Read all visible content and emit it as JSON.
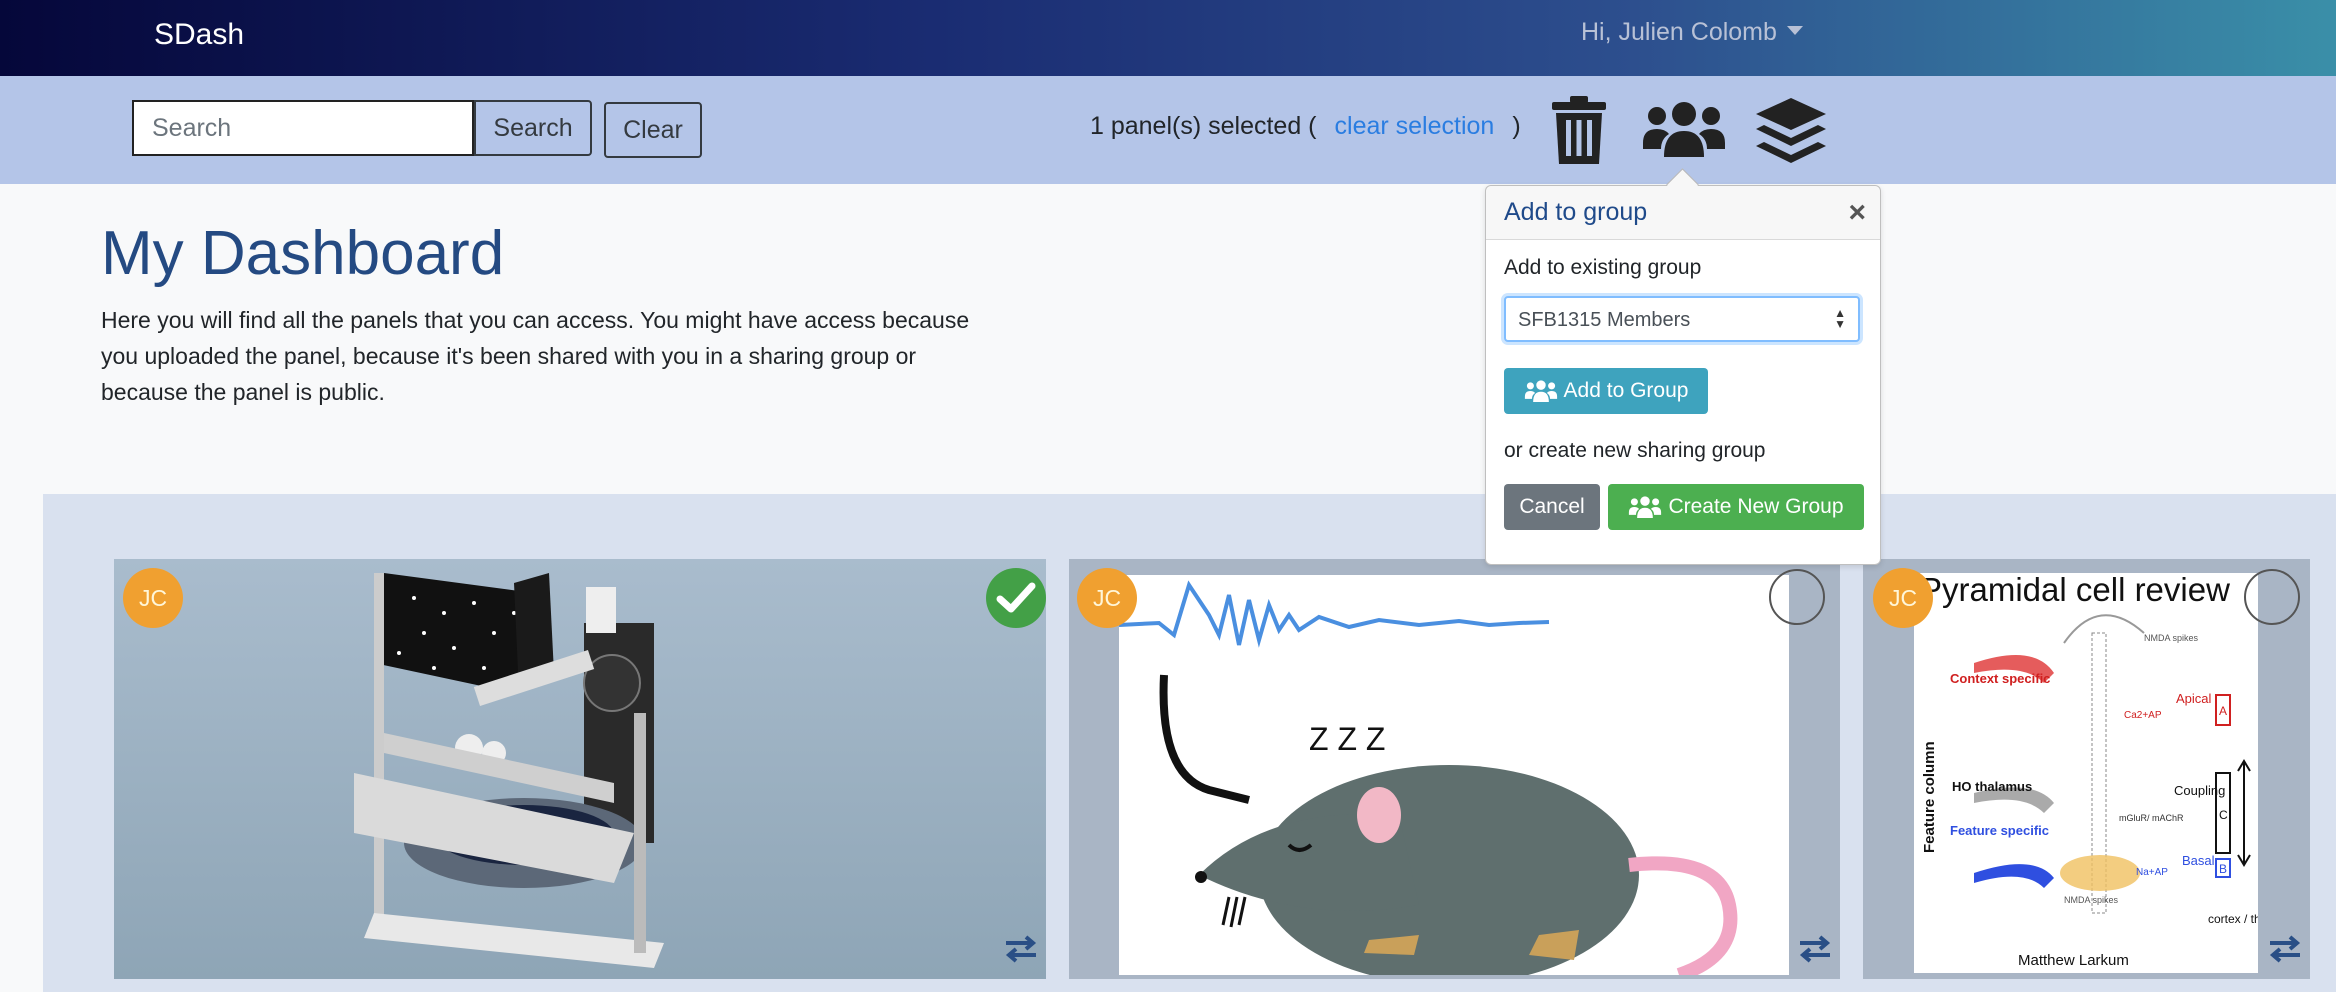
{
  "navbar": {
    "brand": "SDash",
    "user_greeting": "Hi, Julien Colomb"
  },
  "toolbar": {
    "search_placeholder": "Search",
    "search_button": "Search",
    "clear_button": "Clear",
    "selection_prefix": "1 panel(s) selected (",
    "clear_selection_link": "clear selection",
    "selection_suffix": ")"
  },
  "popover": {
    "title": "Add to group",
    "close_symbol": "×",
    "existing_label": "Add to existing group",
    "selected_group": "SFB1315 Members",
    "add_button": "Add to Group",
    "new_label": "or create new sharing group",
    "cancel_button": "Cancel",
    "create_button": "Create New Group"
  },
  "main": {
    "title": "My Dashboard",
    "intro": "Here you will find all the panels that you can access. You might have access because you uploaded the panel, because it's been shared with you in a sharing group or because the panel is public."
  },
  "panels": [
    {
      "owner_initials": "JC",
      "selected": true
    },
    {
      "owner_initials": "JC",
      "selected": false,
      "sleep_text": "Z Z Z"
    },
    {
      "owner_initials": "JC",
      "selected": false,
      "figure_title": "Pyramidal cell review",
      "figure_labels": {
        "context": "Context specific",
        "nmda_top": "NMDA spikes",
        "ca_ap": "Ca2+AP",
        "apical": "Apical",
        "feature_column": "Feature column",
        "ho_thalamus": "HO thalamus",
        "coupling": "Coupling",
        "mglur": "mGluR/ mAChR",
        "feature_specific": "Feature specific",
        "basal": "Basal",
        "na_ap": "Na+AP",
        "nmda_bottom": "NMDA spikes",
        "cortex": "cortex / thalamus",
        "a": "A",
        "c": "C",
        "b": "B",
        "author": "Matthew Larkum"
      }
    }
  ],
  "colors": {
    "brand_title": "#244a82",
    "link": "#2a7de1",
    "toolbar_bg": "#b4c5e8",
    "avatar": "#f0a030",
    "check": "#43a047"
  }
}
